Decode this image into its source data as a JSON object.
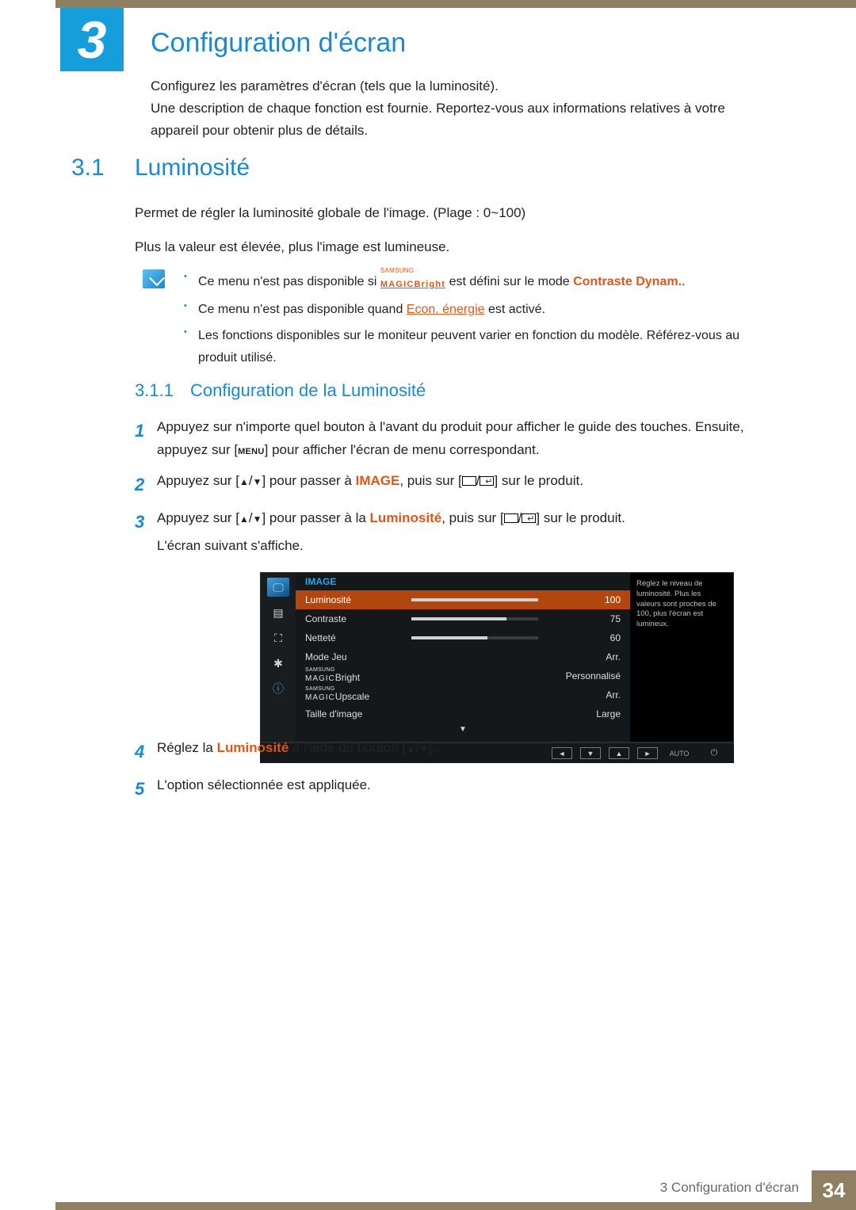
{
  "chapter": {
    "number": "3",
    "title": "Configuration d'écran"
  },
  "intro": {
    "p1": "Configurez les paramètres d'écran (tels que la luminosité).",
    "p2": "Une description de chaque fonction est fournie. Reportez-vous aux informations relatives à votre appareil pour obtenir plus de détails."
  },
  "section": {
    "num": "3.1",
    "title": "Luminosité"
  },
  "body": {
    "p1": "Permet de régler la luminosité globale de l'image. (Plage : 0~100)",
    "p2": "Plus la valeur est élevée, plus l'image est lumineuse."
  },
  "notes": {
    "n1a": "Ce menu n'est pas disponible si ",
    "magic_top": "SAMSUNG",
    "magic_bot": "MAGIC",
    "magic_suffix": "Bright",
    "n1b": " est défini sur le mode ",
    "n1c": "Contraste Dynam.",
    "n1d": ".",
    "n2a": "Ce menu n'est pas disponible quand ",
    "n2b": "Econ. énergie",
    "n2c": " est activé.",
    "n3": "Les fonctions disponibles sur le moniteur peuvent varier en fonction du modèle. Référez-vous au produit utilisé."
  },
  "subsection": {
    "num": "3.1.1",
    "title": "Configuration de la Luminosité"
  },
  "steps": {
    "s1a": "Appuyez sur n'importe quel bouton à l'avant du produit pour afficher le guide des touches. Ensuite, appuyez sur [",
    "s1menu": "MENU",
    "s1b": "] pour afficher l'écran de menu correspondant.",
    "s2a": "Appuyez sur [",
    "s2b": "] pour passer à ",
    "s2c": "IMAGE",
    "s2d": ", puis sur [",
    "s2e": "] sur le produit.",
    "s3a": "Appuyez sur [",
    "s3b": "] pour passer à la ",
    "s3c": "Luminosité",
    "s3d": ", puis sur [",
    "s3e": "] sur le produit.",
    "s3f": "L'écran suivant s'affiche.",
    "s4a": "Réglez la ",
    "s4b": "Luminosité",
    "s4c": " à l'aide du bouton [",
    "s4d": "].",
    "s5": "L'option sélectionnée est appliquée."
  },
  "osd": {
    "head": "IMAGE",
    "help": "Réglez le niveau de luminosité. Plus les valeurs sont proches de 100, plus l'écran est lumineux.",
    "rows": [
      {
        "label": "Luminosité",
        "val": "100",
        "fill": 100,
        "sel": true
      },
      {
        "label": "Contraste",
        "val": "75",
        "fill": 75
      },
      {
        "label": "Netteté",
        "val": "60",
        "fill": 60
      },
      {
        "label": "Mode Jeu",
        "val": "Arr."
      },
      {
        "label_magic": "Bright",
        "val": "Personnalisé"
      },
      {
        "label_magic": "Upscale",
        "val": "Arr."
      },
      {
        "label": "Taille d'image",
        "val": "Large"
      }
    ],
    "magic_top": "SAMSUNG",
    "magic_bot": "MAGIC",
    "auto": "AUTO"
  },
  "footer": {
    "text": "3 Configuration d'écran",
    "page": "34"
  },
  "chart_data": {
    "type": "table",
    "title": "IMAGE OSD menu",
    "rows": [
      {
        "setting": "Luminosité",
        "value": 100
      },
      {
        "setting": "Contraste",
        "value": 75
      },
      {
        "setting": "Netteté",
        "value": 60
      },
      {
        "setting": "Mode Jeu",
        "value": "Arr."
      },
      {
        "setting": "SAMSUNG MAGIC Bright",
        "value": "Personnalisé"
      },
      {
        "setting": "SAMSUNG MAGIC Upscale",
        "value": "Arr."
      },
      {
        "setting": "Taille d'image",
        "value": "Large"
      }
    ]
  }
}
